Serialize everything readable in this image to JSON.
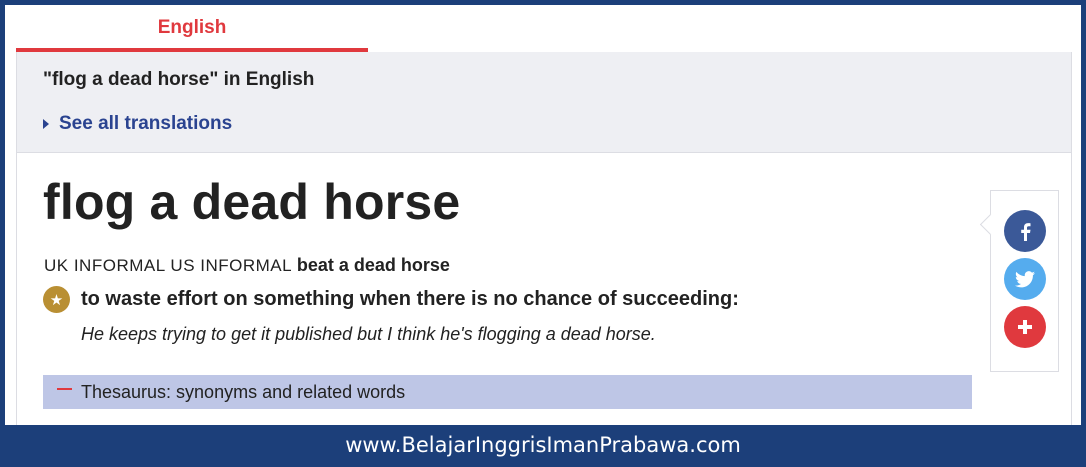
{
  "tabs": {
    "active_label": "English"
  },
  "header": {
    "title": "\"flog a dead horse\" in English",
    "see_all": "See all translations"
  },
  "entry": {
    "headword": "flog a dead horse",
    "uk_label": "UK INFORMAL",
    "us_label": "US INFORMAL",
    "variant": "beat a dead horse",
    "definition": "to waste effort on something when there is no chance of succeeding:",
    "example": "He keeps trying to get it published but I think he's flogging a dead horse.",
    "thesaurus": "Thesaurus: synonyms and related words"
  },
  "share": {
    "icons": [
      "facebook-icon",
      "twitter-icon",
      "plus-icon"
    ]
  },
  "footer": {
    "watermark": "www.BelajarInggrisImanPrabawa.com"
  },
  "colors": {
    "accent_red": "#e0393e",
    "link_blue": "#2a4390",
    "frame_navy": "#1c3f7a",
    "thesaurus_bg": "#bec6e6",
    "star_gold": "#b98f33",
    "facebook": "#3b5998",
    "twitter": "#55acee"
  }
}
